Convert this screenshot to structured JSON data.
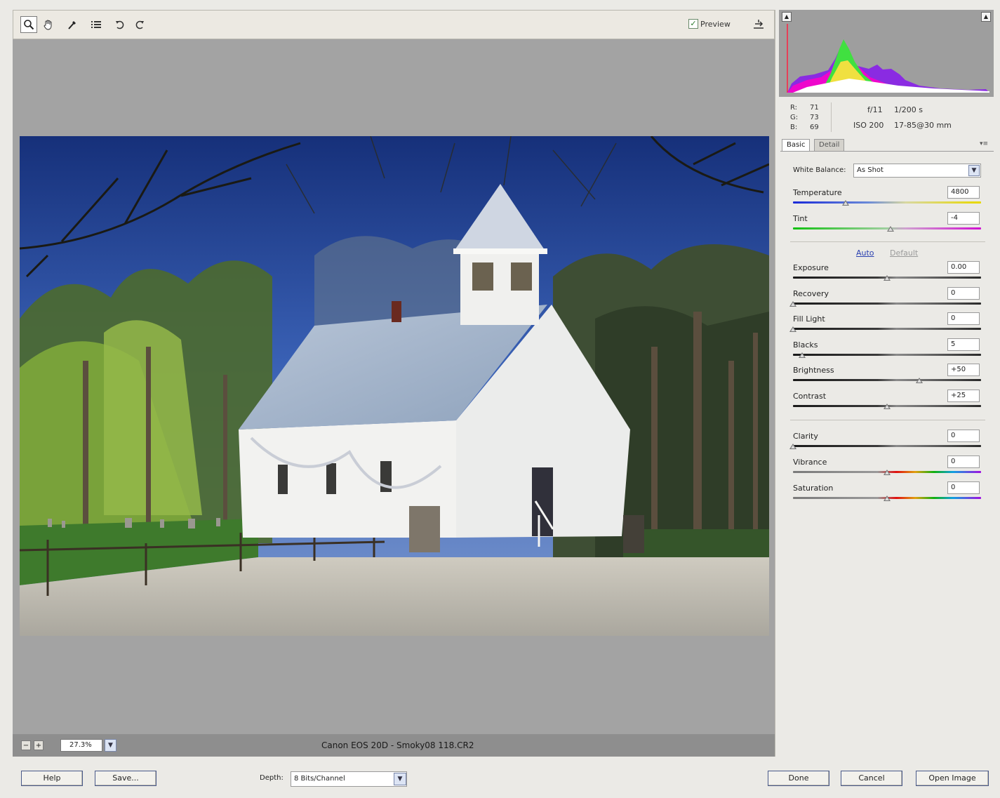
{
  "toolbar": {
    "tools": [
      "zoom-icon",
      "hand-icon",
      "white-balance-icon",
      "list-icon",
      "rotate-left-icon",
      "rotate-right-icon"
    ],
    "preview_label": "Preview",
    "preview_checked": true
  },
  "statusbar": {
    "zoom_minus": "−",
    "zoom_plus": "+",
    "zoom_value": "27.3%",
    "file_info": "Canon EOS 20D  -  Smoky08 118.CR2"
  },
  "info": {
    "r_label": "R:",
    "r_value": "71",
    "g_label": "G:",
    "g_value": "73",
    "b_label": "B:",
    "b_value": "69",
    "aperture": "f/11",
    "shutter": "1/200 s",
    "iso": "ISO 200",
    "lens": "17-85@30 mm"
  },
  "tabs": [
    "Basic",
    "Detail"
  ],
  "basic": {
    "white_balance_label": "White Balance:",
    "white_balance_value": "As Shot",
    "auto_label": "Auto",
    "default_label": "Default",
    "sliders": [
      {
        "label": "Temperature",
        "value": "4800",
        "pos": 0.28,
        "track": "temperature"
      },
      {
        "label": "Tint",
        "value": "-4",
        "pos": 0.52,
        "track": "tint"
      },
      {
        "label": "Exposure",
        "value": "0.00",
        "pos": 0.5,
        "track": "dark"
      },
      {
        "label": "Recovery",
        "value": "0",
        "pos": 0.0,
        "track": "dark"
      },
      {
        "label": "Fill Light",
        "value": "0",
        "pos": 0.0,
        "track": "dark"
      },
      {
        "label": "Blacks",
        "value": "5",
        "pos": 0.05,
        "track": "dark"
      },
      {
        "label": "Brightness",
        "value": "+50",
        "pos": 0.67,
        "track": "dark"
      },
      {
        "label": "Contrast",
        "value": "+25",
        "pos": 0.5,
        "track": "dark"
      },
      {
        "label": "Clarity",
        "value": "0",
        "pos": 0.0,
        "track": "dark"
      },
      {
        "label": "Vibrance",
        "value": "0",
        "pos": 0.5,
        "track": "rainbow"
      },
      {
        "label": "Saturation",
        "value": "0",
        "pos": 0.5,
        "track": "rainbow"
      }
    ]
  },
  "bottom": {
    "help_label": "Help",
    "save_label": "Save...",
    "depth_label": "Depth:",
    "depth_value": "8 Bits/Channel",
    "done_label": "Done",
    "cancel_label": "Cancel",
    "open_label": "Open Image"
  },
  "colors": {
    "canvas_bg": "#a3a3a3",
    "accent_link": "#2a40b0"
  }
}
